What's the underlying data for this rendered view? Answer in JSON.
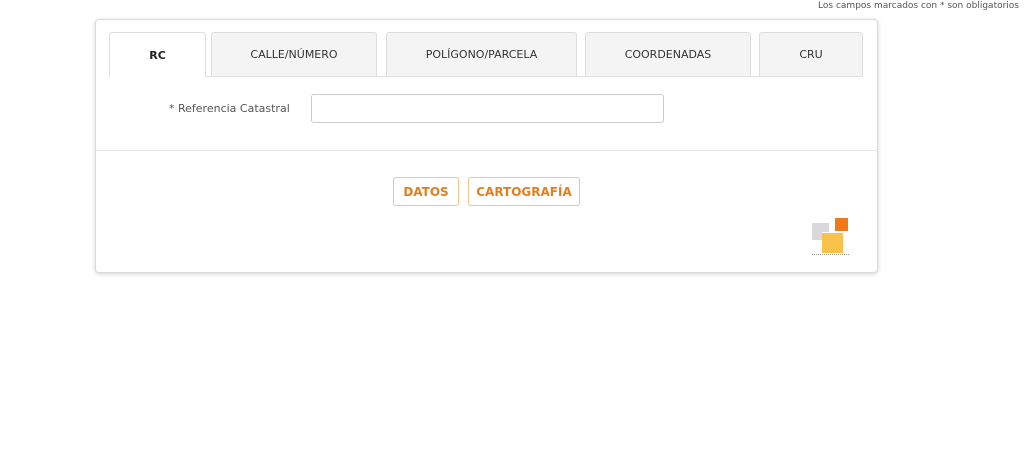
{
  "required_note": "Los campos marcados con * son obligatorios",
  "tabs": [
    {
      "label": "RC",
      "active": true
    },
    {
      "label": "CALLE/NÚMERO",
      "active": false
    },
    {
      "label": "POLÍGONO/PARCELA",
      "active": false
    },
    {
      "label": "COORDENADAS",
      "active": false
    },
    {
      "label": "CRU",
      "active": false
    }
  ],
  "form": {
    "ref_label": "* Referencia Catastral",
    "ref_value": "",
    "ref_placeholder": ""
  },
  "actions": {
    "datos_label": "DATOS",
    "cartografia_label": "CARTOGRAFÍA"
  },
  "colors": {
    "accent": "#e07f1d",
    "button_border": "#f0c28e",
    "logo_orange": "#f07a1a",
    "logo_yellow": "#f9c24a",
    "logo_grey": "#d9d9d9"
  }
}
